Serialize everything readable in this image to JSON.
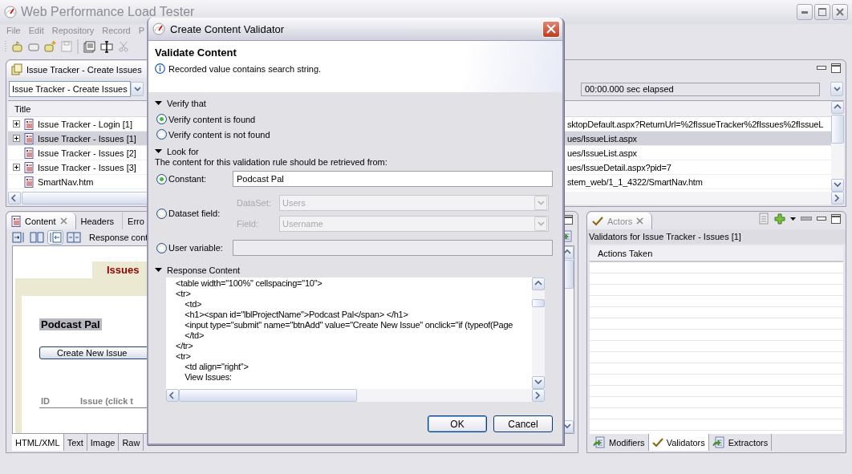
{
  "window": {
    "title": "Web Performance Load Tester"
  },
  "menu": [
    "File",
    "Edit",
    "Repository",
    "Record",
    "P"
  ],
  "editor": {
    "tab": "Issue Tracker - Create Issues",
    "combo_value": "Issue Tracker - Create Issues",
    "elapsed": "00:00.000 sec elapsed",
    "columns": [
      "Title"
    ],
    "rows": [
      {
        "title": "Issue Tracker - Login [1]",
        "url": "sktopDefault.aspx?ReturnUrl=%2fIssueTracker%2fIssues%2fIssueL",
        "expandable": true,
        "selected": false
      },
      {
        "title": "Issue Tracker - Issues [1]",
        "url": "ues/IssueList.aspx",
        "expandable": true,
        "selected": true
      },
      {
        "title": "Issue Tracker - Issues [2]",
        "url": "ues/IssueList.aspx",
        "expandable": false,
        "selected": false
      },
      {
        "title": "Issue Tracker - Issues [3]",
        "url": "ues/IssueDetail.aspx?pid=7",
        "expandable": true,
        "selected": false
      },
      {
        "title": "SmartNav.htm",
        "url": "stem_web/1_1_4322/SmartNav.htm",
        "expandable": false,
        "selected": false
      }
    ]
  },
  "content_view": {
    "tabs": [
      {
        "label": "Content",
        "selected": true
      },
      {
        "label": "Headers",
        "selected": false
      },
      {
        "label": "Erro",
        "selected": false
      }
    ],
    "toolbar_label": "Response cont",
    "preview": {
      "heading": "Issues",
      "project": "Podcast Pal",
      "button": "Create New Issue",
      "columns": [
        "ID",
        "Issue (click t"
      ]
    },
    "bottom_tabs": [
      {
        "label": "HTML/XML",
        "selected": true
      },
      {
        "label": "Text",
        "selected": false
      },
      {
        "label": "Image",
        "selected": false
      },
      {
        "label": "Raw",
        "selected": false
      }
    ]
  },
  "actors": {
    "tab": "Actors",
    "title": "Validators for Issue Tracker - Issues [1]",
    "columns": [
      "Actions Taken"
    ],
    "bottom_tabs": [
      {
        "label": "Modifiers",
        "kind": "modifiers",
        "selected": false
      },
      {
        "label": "Validators",
        "kind": "validators",
        "selected": true
      },
      {
        "label": "Extractors",
        "kind": "extractors",
        "selected": false
      }
    ]
  },
  "dialog": {
    "title": "Create Content Validator",
    "heading": "Validate Content",
    "message": "Recorded value contains search string.",
    "verify": {
      "label": "Verify that",
      "options": [
        {
          "label": "Verify content is found",
          "selected": true
        },
        {
          "label": "Verify content is not found",
          "selected": false
        }
      ]
    },
    "look_for": {
      "label": "Look for",
      "description": "The content for this validation rule should be retrieved from:",
      "sources": [
        {
          "kind": "constant",
          "label": "Constant:",
          "selected": true,
          "value": "Podcast Pal"
        },
        {
          "kind": "dataset",
          "label": "Dataset field:",
          "selected": false,
          "fields": [
            {
              "label": "DataSet:",
              "value": "Users"
            },
            {
              "label": "Field:",
              "value": "Username"
            }
          ]
        },
        {
          "kind": "variable",
          "label": "User variable:",
          "selected": false
        }
      ]
    },
    "response": {
      "label": "Response Content",
      "lines": [
        "<table width=\"100%\" cellspacing=\"10\">",
        "<tr>",
        "    <td>",
        "    <h1><span id=\"lblProjectName\">Podcast Pal</span> </h1>",
        "    <input type=\"submit\" name=\"btnAdd\" value=\"Create New Issue\" onclick=\"if (typeof(Page",
        "    </td>",
        "</tr>",
        "<tr>",
        "    <td align=\"right\">",
        "    View Issues:"
      ]
    },
    "buttons": [
      "OK",
      "Cancel"
    ]
  }
}
